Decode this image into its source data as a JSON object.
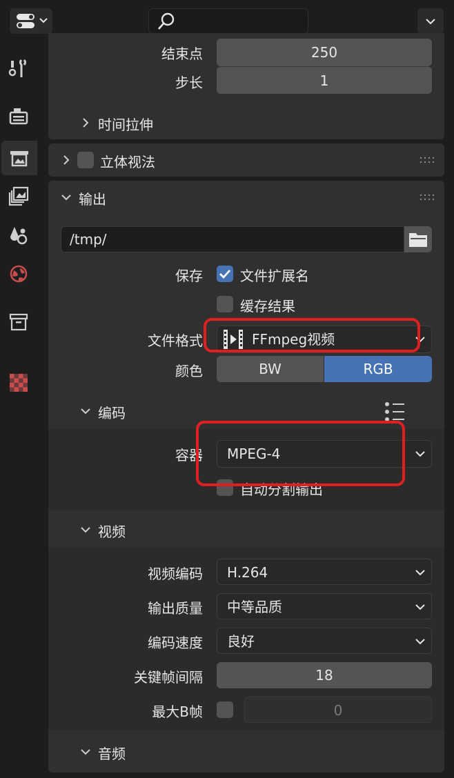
{
  "search": {
    "placeholder": ""
  },
  "sidebar": {
    "tabs": [
      {
        "name": "tool",
        "icon": "tool-icon"
      },
      {
        "name": "render",
        "icon": "render-icon"
      },
      {
        "name": "output",
        "icon": "output-icon",
        "active": true
      },
      {
        "name": "view-layer",
        "icon": "view-layer-icon"
      },
      {
        "name": "scene",
        "icon": "scene-icon"
      },
      {
        "name": "world",
        "icon": "world-icon"
      },
      {
        "name": "collection",
        "icon": "collection-icon"
      },
      {
        "name": "texture",
        "icon": "texture-icon"
      }
    ]
  },
  "frame_range": {
    "end_label": "结束点",
    "end_value": "250",
    "step_label": "步长",
    "step_value": "1",
    "time_stretch_label": "时间拉伸"
  },
  "stereoscopy": {
    "title": "立体视法",
    "enabled": false
  },
  "output": {
    "title": "输出",
    "path": "/tmp/",
    "save_label": "保存",
    "file_extensions_label": "文件扩展名",
    "file_extensions": true,
    "cache_result_label": "缓存结果",
    "cache_result": false,
    "file_format_label": "文件格式",
    "file_format": "FFmpeg视频",
    "color_label": "颜色",
    "color_bw": "BW",
    "color_rgb": "RGB",
    "color_selected": "RGB"
  },
  "encoding": {
    "title": "编码",
    "container_label": "容器",
    "container": "MPEG-4",
    "autosplit_label": "自动分割输出",
    "autosplit": false
  },
  "video": {
    "title": "视频",
    "codec_label": "视频编码",
    "codec": "H.264",
    "quality_label": "输出质量",
    "quality": "中等品质",
    "speed_label": "编码速度",
    "speed": "良好",
    "keyframe_label": "关键帧间隔",
    "keyframe": "18",
    "maxb_label": "最大B帧",
    "maxb_enabled": false,
    "maxb": "0"
  },
  "audio": {
    "title": "音频"
  },
  "colors": {
    "accent": "#4772b3",
    "annotation": "#e02020",
    "panel": "#303030",
    "field": "#545454"
  }
}
